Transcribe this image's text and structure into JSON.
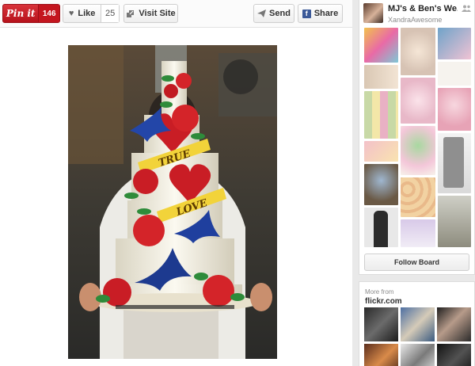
{
  "toolbar": {
    "pinit_label": "Pin it",
    "pin_count": "146",
    "like_label": "Like",
    "like_count": "25",
    "visit_label": "Visit Site",
    "send_label": "Send",
    "share_label": "Share"
  },
  "pin": {
    "image_icon": "cake-photo",
    "banner_top": "TRUE",
    "banner_bottom": "LOVE"
  },
  "board": {
    "title": "MJ's & Ben's We...",
    "owner": "XandraAwesome",
    "group_icon": "group-board-icon",
    "follow_label": "Follow Board"
  },
  "more": {
    "label": "More from",
    "source": "flickr.com"
  },
  "colors": {
    "pinterest_red": "#cb2027",
    "facebook_blue": "#3b5998"
  }
}
